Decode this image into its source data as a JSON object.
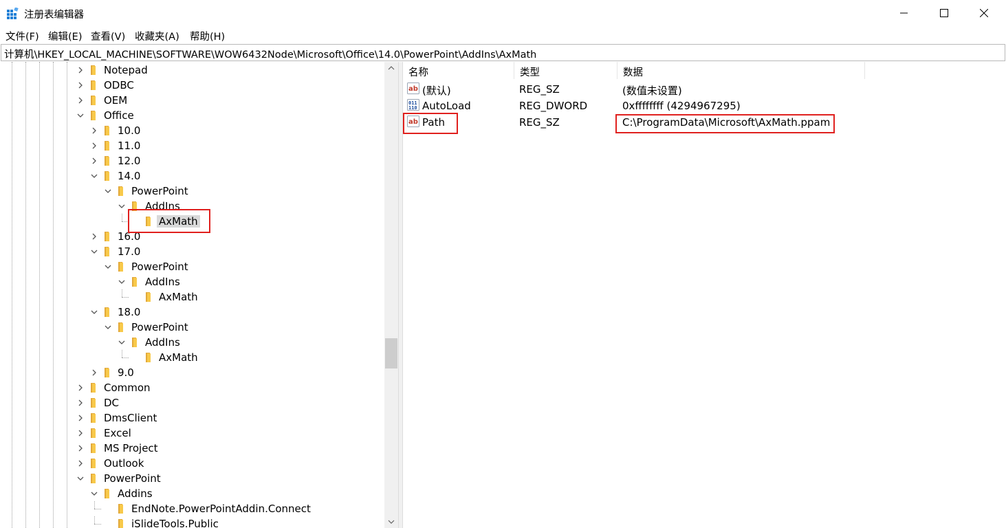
{
  "window": {
    "title": "注册表编辑器"
  },
  "menu": {
    "items": [
      "文件(F)",
      "编辑(E)",
      "查看(V)",
      "收藏夹(A)",
      "帮助(H)"
    ]
  },
  "address": {
    "path": "计算机\\HKEY_LOCAL_MACHINE\\SOFTWARE\\WOW6432Node\\Microsoft\\Office\\14.0\\PowerPoint\\AddIns\\AxMath"
  },
  "tree": {
    "nodes": [
      {
        "label": "Notepad",
        "expanded": false,
        "has_children": true
      },
      {
        "label": "ODBC",
        "expanded": false,
        "has_children": true
      },
      {
        "label": "OEM",
        "expanded": false,
        "has_children": true
      },
      {
        "label": "Office",
        "expanded": true,
        "has_children": true
      },
      {
        "label": "10.0",
        "expanded": false,
        "has_children": true
      },
      {
        "label": "11.0",
        "expanded": false,
        "has_children": true
      },
      {
        "label": "12.0",
        "expanded": false,
        "has_children": true
      },
      {
        "label": "14.0",
        "expanded": true,
        "has_children": true
      },
      {
        "label": "PowerPoint",
        "expanded": true,
        "has_children": true
      },
      {
        "label": "AddIns",
        "expanded": true,
        "has_children": true
      },
      {
        "label": "AxMath",
        "expanded": false,
        "has_children": false,
        "selected": true
      },
      {
        "label": "16.0",
        "expanded": false,
        "has_children": true
      },
      {
        "label": "17.0",
        "expanded": true,
        "has_children": true
      },
      {
        "label": "PowerPoint",
        "expanded": true,
        "has_children": true
      },
      {
        "label": "AddIns",
        "expanded": true,
        "has_children": true
      },
      {
        "label": "AxMath",
        "expanded": false,
        "has_children": false
      },
      {
        "label": "18.0",
        "expanded": true,
        "has_children": true
      },
      {
        "label": "PowerPoint",
        "expanded": true,
        "has_children": true
      },
      {
        "label": "AddIns",
        "expanded": true,
        "has_children": true
      },
      {
        "label": "AxMath",
        "expanded": false,
        "has_children": false
      },
      {
        "label": "9.0",
        "expanded": false,
        "has_children": true
      },
      {
        "label": "Common",
        "expanded": false,
        "has_children": true
      },
      {
        "label": "DC",
        "expanded": false,
        "has_children": true
      },
      {
        "label": "DmsClient",
        "expanded": false,
        "has_children": true
      },
      {
        "label": "Excel",
        "expanded": false,
        "has_children": true
      },
      {
        "label": "MS Project",
        "expanded": false,
        "has_children": true
      },
      {
        "label": "Outlook",
        "expanded": false,
        "has_children": true
      },
      {
        "label": "PowerPoint",
        "expanded": true,
        "has_children": true
      },
      {
        "label": "Addins",
        "expanded": true,
        "has_children": true
      },
      {
        "label": "EndNote.PowerPointAddin.Connect",
        "expanded": false,
        "has_children": false
      },
      {
        "label": "iSlideTools.Public",
        "expanded": false,
        "has_children": false
      }
    ]
  },
  "list": {
    "columns": [
      "名称",
      "类型",
      "数据"
    ],
    "rows": [
      {
        "name": "(默认)",
        "type": "REG_SZ",
        "data": "(数值未设置)",
        "icon": "string-value-icon"
      },
      {
        "name": "AutoLoad",
        "type": "REG_DWORD",
        "data": "0xffffffff (4294967295)",
        "icon": "binary-value-icon"
      },
      {
        "name": "Path",
        "type": "REG_SZ",
        "data": "C:\\ProgramData\\Microsoft\\AxMath.ppam",
        "icon": "string-value-icon"
      }
    ]
  },
  "colors": {
    "highlight_border": "#e0201e",
    "folder": "#f8c94a",
    "selection": "#d9d9d9"
  }
}
